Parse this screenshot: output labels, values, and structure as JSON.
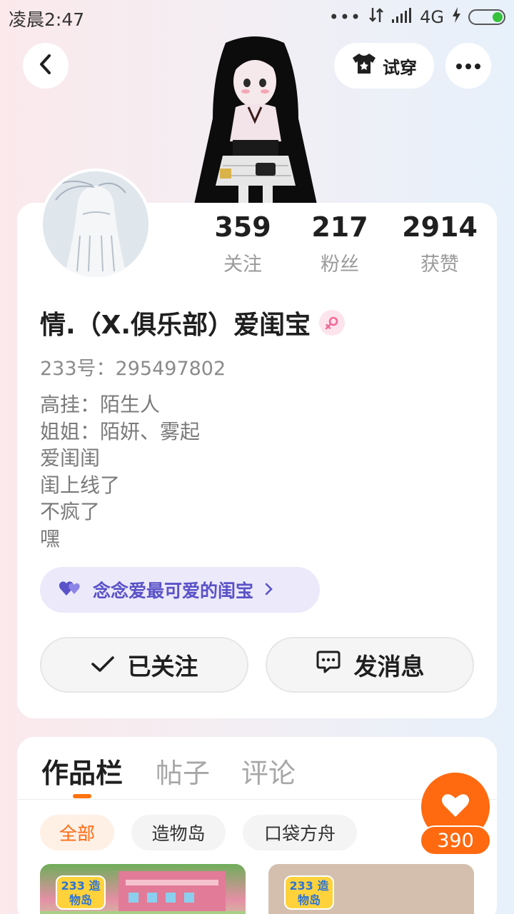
{
  "status_bar": {
    "time": "凌晨2:47",
    "network": "4G",
    "more_dots": "•••"
  },
  "header": {
    "try_on_label": "试穿"
  },
  "profile": {
    "username": "情.（X.俱乐部）爱闺宝",
    "uid_label": "233号：",
    "uid": "295497802",
    "stats": [
      {
        "value": "359",
        "label": "关注"
      },
      {
        "value": "217",
        "label": "粉丝"
      },
      {
        "value": "2914",
        "label": "获赞"
      }
    ],
    "bio_lines": [
      "高挂：陌生人",
      "姐姐：陌妍、雾起",
      "爱闺闺",
      "闺上线了",
      "不疯了",
      "嘿"
    ],
    "tag": "念念爱最可爱的闺宝",
    "follow_label": "已关注",
    "message_label": "发消息"
  },
  "tabs": [
    {
      "label": "作品栏",
      "active": true
    },
    {
      "label": "帖子",
      "active": false
    },
    {
      "label": "评论",
      "active": false
    }
  ],
  "filter_chips": [
    {
      "label": "全部",
      "active": true
    },
    {
      "label": "造物岛",
      "active": false
    },
    {
      "label": "口袋方舟",
      "active": false
    }
  ],
  "thumbnails": [
    {
      "logo_text": "233 造物岛"
    },
    {
      "logo_text": "233 造物岛"
    }
  ],
  "floating_like": {
    "count": "390"
  },
  "colors": {
    "accent": "#ff6a10",
    "tag_bg": "#ece9fb",
    "tag_text": "#5a52c8",
    "gender_pink": "#f06a9a"
  },
  "icons": {
    "back": "chevron-left-icon",
    "try_on": "tshirt-icon",
    "more": "more-dots-icon",
    "gender": "female-icon",
    "tag": "hearts-icon",
    "follow": "check-icon",
    "message": "chat-bubble-icon",
    "like": "heart-icon"
  }
}
